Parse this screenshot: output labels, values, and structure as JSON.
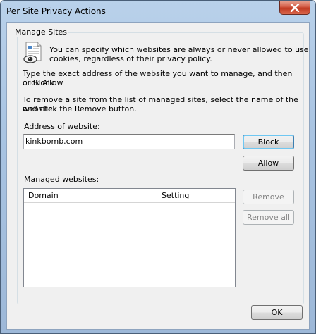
{
  "window": {
    "title": "Per Site Privacy Actions"
  },
  "group": {
    "label": "Manage Sites"
  },
  "info": {
    "line1": "You can specify which websites are always or never allowed to use",
    "line2": "cookies, regardless of their privacy policy."
  },
  "instructions": {
    "type_line1": "Type the exact address of the website you want to manage, and then click Allow",
    "type_line2": "or Block.",
    "remove_line1": "To remove a site from the list of managed sites, select the name of the website",
    "remove_line2": "and click the Remove button."
  },
  "address": {
    "label": "Address of website:",
    "value": "kinkbomb.com"
  },
  "buttons": {
    "block": "Block",
    "allow": "Allow",
    "remove": "Remove",
    "remove_all": "Remove all",
    "ok": "OK"
  },
  "managed": {
    "label": "Managed websites:",
    "columns": [
      "Domain",
      "Setting"
    ],
    "rows": []
  },
  "icons": {
    "close": "close-icon",
    "info": "privacy-document-eye-icon"
  }
}
